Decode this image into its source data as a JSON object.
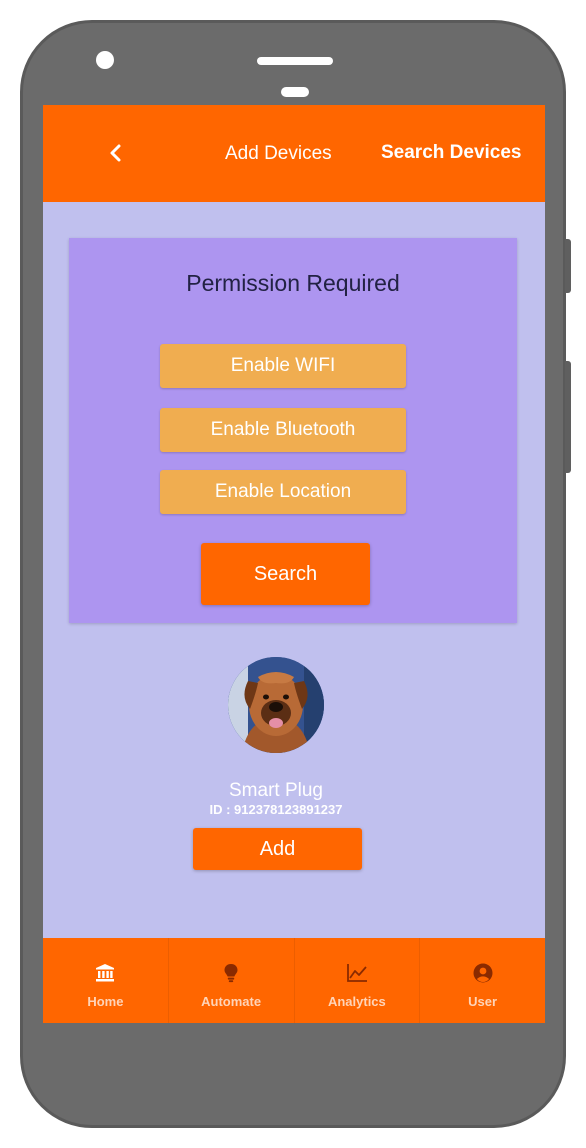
{
  "header": {
    "back_icon": "chevron-left-icon",
    "tabs": [
      {
        "label": "Add Devices",
        "active": false
      },
      {
        "label": "Search Devices",
        "active": true
      }
    ]
  },
  "permissions": {
    "title": "Permission Required",
    "buttons": [
      "Enable WIFI",
      "Enable Bluetooth",
      "Enable Location"
    ],
    "search_label": "Search"
  },
  "device": {
    "avatar": "dog-photo",
    "name": "Smart Plug",
    "id_text": "ID : 912378123891237",
    "add_label": "Add"
  },
  "nav": {
    "items": [
      {
        "label": "Home",
        "icon": "bank-icon"
      },
      {
        "label": "Automate",
        "icon": "lightbulb-icon"
      },
      {
        "label": "Analytics",
        "icon": "chart-line-icon"
      },
      {
        "label": "User",
        "icon": "user-circle-icon"
      }
    ]
  },
  "colors": {
    "primary": "#ff6600",
    "background": "#c0c0ee",
    "card": "#ad95f0",
    "enable_button": "#f0ad50"
  }
}
